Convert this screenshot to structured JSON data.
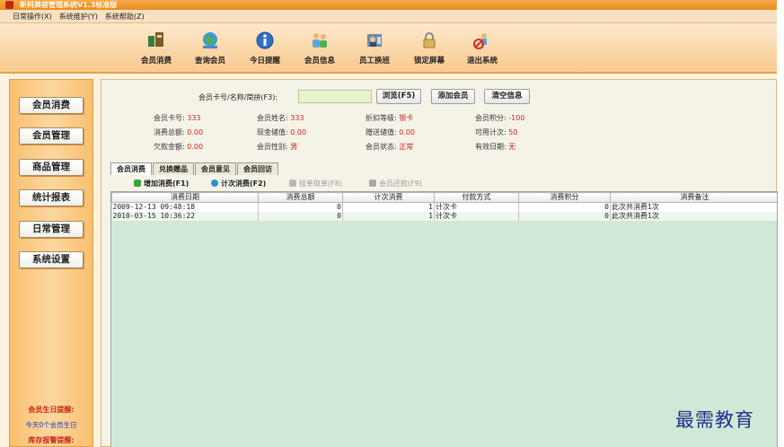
{
  "window": {
    "title": "新科美容管理系统V1.3标准版"
  },
  "menu": {
    "items": [
      "日常操作(X)",
      "系统维护(Y)",
      "系统帮助(Z)"
    ]
  },
  "toolbar": {
    "items": [
      {
        "label": "会员消费",
        "icon": "member-consume-icon"
      },
      {
        "label": "查询会员",
        "icon": "globe-search-icon"
      },
      {
        "label": "今日提醒",
        "icon": "info-icon"
      },
      {
        "label": "会员信息",
        "icon": "people-icon"
      },
      {
        "label": "员工换班",
        "icon": "shift-icon"
      },
      {
        "label": "锁定屏幕",
        "icon": "lock-icon"
      },
      {
        "label": "退出系统",
        "icon": "exit-icon"
      }
    ]
  },
  "sidebar": {
    "items": [
      "会员消费",
      "会员管理",
      "商品管理",
      "统计报表",
      "日常管理",
      "系统设置"
    ],
    "birthday_title": "会员生日提醒:",
    "birthday_text": "今天0个会员生日",
    "stock_title": "库存报警提醒:"
  },
  "search": {
    "label": "会员卡号/名称/简拼(F3):",
    "value": "",
    "browse_btn": "浏览(F5)",
    "add_btn": "添加会员",
    "clear_btn": "清空信息"
  },
  "member": {
    "card_no_label": "会员卡号:",
    "card_no": "333",
    "name_label": "会员姓名:",
    "name": "333",
    "discount_label": "折扣等级:",
    "discount": "银卡",
    "points_label": "会员积分:",
    "points": "-100",
    "consume_total_label": "消费总额:",
    "consume_total": "0.00",
    "cash_value_label": "现金储值:",
    "cash_value": "0.00",
    "gift_value_label": "赠送储值:",
    "gift_value": "0.00",
    "times_label": "可用计次:",
    "times": "50",
    "debt_label": "欠款金额:",
    "debt": "0.00",
    "gender_label": "会员性别:",
    "gender": "男",
    "status_label": "会员状态:",
    "status": "正常",
    "expire_label": "有效日期:",
    "expire": "无"
  },
  "tabs": [
    "会员消费",
    "兑换赠品",
    "会员意见",
    "会员回访"
  ],
  "actions": {
    "add_consume": "增加消费(F1)",
    "times_consume": "计次消费(F2)",
    "hang_order": "挂单取单(F8)",
    "repay": "会员还款(F9)"
  },
  "table": {
    "columns": [
      "消费日期",
      "消费总额",
      "计次消费",
      "付款方式",
      "消费积分",
      "消费备注"
    ],
    "rows": [
      [
        "2009-12-13 09:48:18",
        "0",
        "1",
        "计次卡",
        "0",
        "此次共消费1次"
      ],
      [
        "2010-03-15 10:36:22",
        "0",
        "1",
        "计次卡",
        "0",
        "此次共消费1次"
      ]
    ]
  },
  "watermark": "最需教育",
  "colors": {
    "accent": "#f5a94a",
    "value_red": "#c8261b",
    "grid_bg": "#cfe9d6"
  }
}
